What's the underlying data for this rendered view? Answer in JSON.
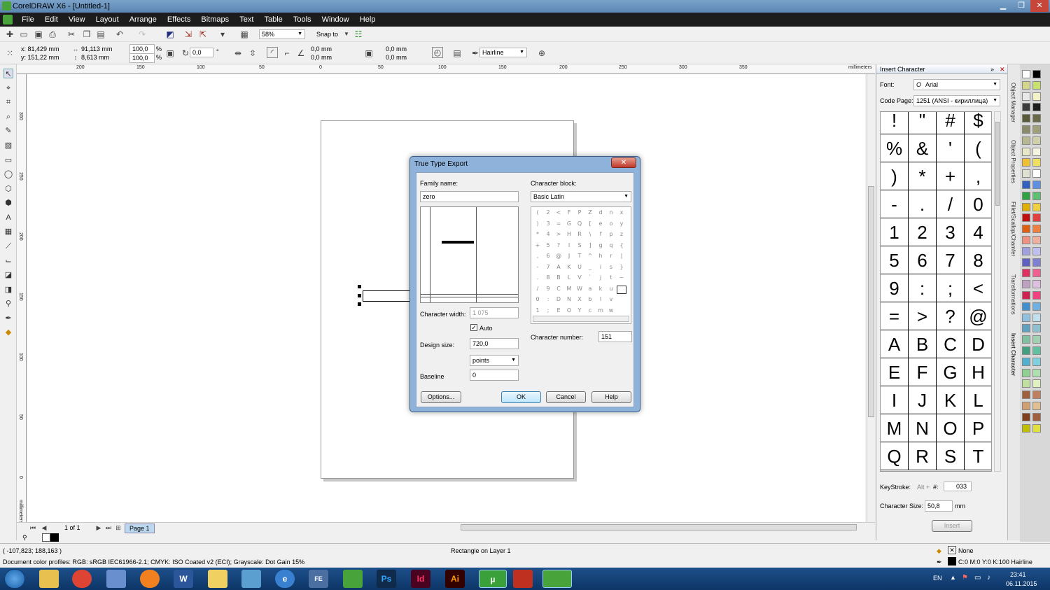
{
  "window": {
    "title": "CorelDRAW X6 - [Untitled-1]"
  },
  "menu": [
    "File",
    "Edit",
    "View",
    "Layout",
    "Arrange",
    "Effects",
    "Bitmaps",
    "Text",
    "Table",
    "Tools",
    "Window",
    "Help"
  ],
  "toolbar": {
    "zoom": "58%",
    "snap_to": "Snap to"
  },
  "propbar": {
    "x": "x: 81,429 mm",
    "y": "y: 151,22 mm",
    "w": "91,113 mm",
    "h": "8,613 mm",
    "sx": "100,0",
    "sy": "100,0",
    "pct": "%",
    "angle": "0,0",
    "deg": "°",
    "c1": "0,0 mm",
    "c2": "0,0 mm",
    "c3": "0,0 mm",
    "c4": "0,0 mm",
    "outline": "Hairline"
  },
  "ruler": {
    "h_ticks": [
      "200",
      "150",
      "100",
      "50",
      "0",
      "50",
      "100",
      "150",
      "200",
      "250",
      "300",
      "350"
    ],
    "v_ticks": [
      "300",
      "250",
      "200",
      "150",
      "100",
      "50",
      "0"
    ],
    "unit": "millimeters"
  },
  "dialog": {
    "title": "True Type Export",
    "family_label": "Family name:",
    "family_value": "zero",
    "charblock_label": "Character block:",
    "charblock_value": "Basic Latin",
    "charwidth_label": "Character width:",
    "charwidth_value": "1 075",
    "auto_label": "Auto",
    "designsize_label": "Design size:",
    "designsize_value": "720,0",
    "units_value": "points",
    "baseline_label": "Baseline",
    "baseline_value": "0",
    "charnum_label": "Character number:",
    "charnum_value": "151",
    "options": "Options...",
    "ok": "OK",
    "cancel": "Cancel",
    "help": "Help",
    "chars": [
      [
        "(",
        "2",
        "<",
        "F",
        "P",
        "Z",
        "d",
        "n",
        "x"
      ],
      [
        ")",
        "3",
        "=",
        "G",
        "Q",
        "[",
        "e",
        "o",
        "y"
      ],
      [
        "*",
        "4",
        ">",
        "H",
        "R",
        "\\",
        "f",
        "p",
        "z"
      ],
      [
        "+",
        "5",
        "?",
        "I",
        "S",
        "]",
        "g",
        "q",
        "{"
      ],
      [
        ",",
        "6",
        "@",
        "J",
        "T",
        "^",
        "h",
        "r",
        "|"
      ],
      [
        "-",
        "7",
        "A",
        "K",
        "U",
        "_",
        "i",
        "s",
        "}"
      ],
      [
        ".",
        "8",
        "B",
        "L",
        "V",
        "`",
        "j",
        "t",
        "~"
      ],
      [
        "/",
        "9",
        "C",
        "M",
        "W",
        "a",
        "k",
        "u",
        ""
      ],
      [
        "0",
        ":",
        "D",
        "N",
        "X",
        "b",
        "l",
        "v",
        ""
      ],
      [
        "1",
        ";",
        "E",
        "O",
        "Y",
        "c",
        "m",
        "w",
        ""
      ]
    ]
  },
  "docker": {
    "title": "Insert Character",
    "font_label": "Font:",
    "font_value": "Arial",
    "codepage_label": "Code Page:",
    "codepage_value": "1251  (ANSI - кириллица)",
    "glyphs": [
      "!",
      "\"",
      "#",
      "$",
      "%",
      "&",
      "'",
      "(",
      ")",
      "*",
      "+",
      ",",
      "-",
      ".",
      "/",
      "0",
      "1",
      "2",
      "3",
      "4",
      "5",
      "6",
      "7",
      "8",
      "9",
      ":",
      ";",
      "<",
      "=",
      ">",
      "?",
      "@",
      "A",
      "B",
      "C",
      "D",
      "E",
      "F",
      "G",
      "H",
      "I",
      "J",
      "K",
      "L",
      "M",
      "N",
      "O",
      "P",
      "Q",
      "R",
      "S",
      "T"
    ],
    "keystroke_label": "KeyStroke:",
    "keystroke_alt": "Alt +",
    "keystroke_hash": "#:",
    "keystroke_value": "033",
    "charsize_label": "Character Size:",
    "charsize_value": "50,8",
    "charsize_unit": "mm",
    "insert": "Insert",
    "tabs": [
      "Object Manager",
      "Object Properties",
      "Fillet/Scallop/Chamfer",
      "Transformations",
      "Insert Character"
    ]
  },
  "pagebar": {
    "count": "1 of 1",
    "tab": "Page 1"
  },
  "status": {
    "coords": "( -107,823; 188,163 )",
    "object": "Rectangle on Layer 1",
    "profiles": "Document color profiles: RGB: sRGB IEC61966-2.1; CMYK: ISO Coated v2 (ECI); Grayscale: Dot Gain 15%",
    "fill": "None",
    "outline": "C:0 M:0 Y:0 K:100  Hairline"
  },
  "taskbar": {
    "lang": "EN",
    "time": "23:41",
    "date": "06.11.2015",
    "apps": [
      "explorer",
      "chrome",
      "calculator",
      "firefox",
      "word",
      "folder",
      "notepad",
      "ie",
      "fe",
      "corel",
      "ps",
      "id",
      "ai",
      "utorrent",
      "ccleaner",
      "coreldraw"
    ]
  },
  "palette_colors": [
    "#ffffff",
    "#000000",
    "#d4d48a",
    "#c8e06e",
    "#e8e8e8",
    "#f2f2c6",
    "#3a3a3a",
    "#1e1e1e",
    "#5a5a3a",
    "#6a6a4a",
    "#8a8a6a",
    "#a0a07a",
    "#b8b890",
    "#d0d0aa",
    "#e8e8c8",
    "#f4f4e0",
    "#f0c030",
    "#f0e060",
    "#e0e0d0",
    "#ffffff",
    "#3060c0",
    "#6090e0",
    "#30a040",
    "#60c070",
    "#e0b000",
    "#f0d040",
    "#c01010",
    "#e04040",
    "#e06010",
    "#f08040",
    "#f09080",
    "#f0b0a0",
    "#a0a0e0",
    "#c0c0f0",
    "#6060c0",
    "#8080d0",
    "#e03060",
    "#f06090",
    "#c0a0c0",
    "#e0c0e0",
    "#d02050",
    "#f04080",
    "#4090d0",
    "#70b0e0",
    "#90c0e0",
    "#c0e0f0",
    "#60a0c0",
    "#90c0d0",
    "#80c0a0",
    "#a0d0b0",
    "#40a080",
    "#60c0a0",
    "#50b0d0",
    "#80d0e0",
    "#90d090",
    "#b0e0b0",
    "#c0e0a0",
    "#e0f0c0",
    "#a06040",
    "#c08060",
    "#d0a070",
    "#e0c090",
    "#804020",
    "#a06040",
    "#c0c000",
    "#e0e040"
  ]
}
